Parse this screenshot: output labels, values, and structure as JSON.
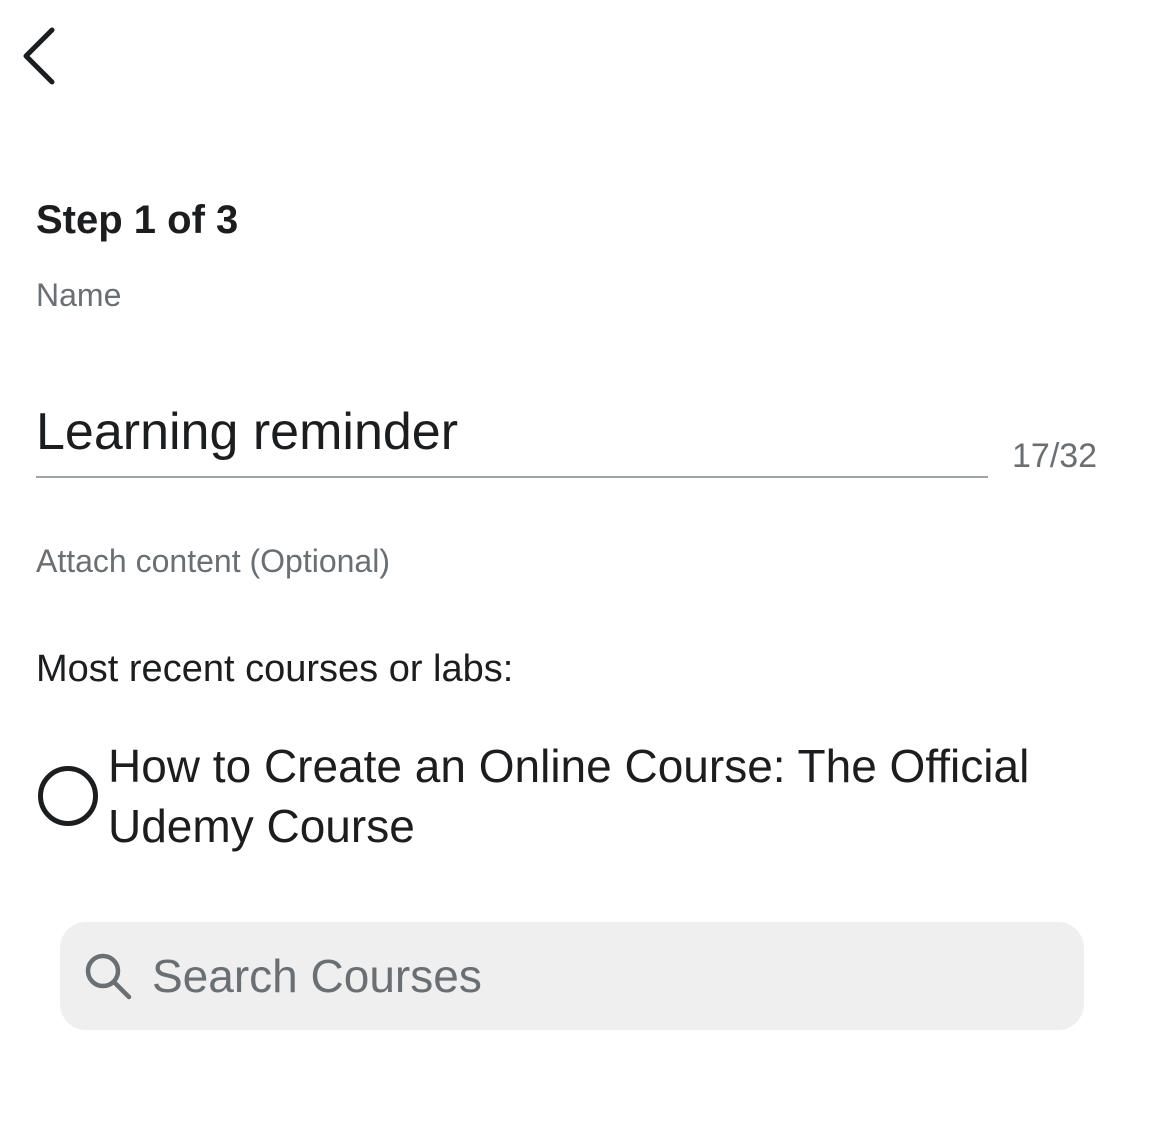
{
  "header": {
    "back_icon": "chevron-left-icon"
  },
  "form": {
    "step_label": "Step 1 of 3",
    "name_label": "Name",
    "name_value": "Learning reminder",
    "char_counter": "17/32",
    "attach_label": "Attach content (Optional)",
    "recent_heading": "Most recent courses or labs:",
    "courses": [
      {
        "title": "How to Create an Online Course: The Official Udemy Course",
        "selected": false
      }
    ]
  },
  "search": {
    "icon": "search-icon",
    "placeholder": "Search Courses"
  },
  "colors": {
    "primary_text": "#1c1d1f",
    "secondary_text": "#6a6f73",
    "field_underline": "#9da3a7",
    "search_background": "#efefef",
    "background": "#ffffff"
  }
}
